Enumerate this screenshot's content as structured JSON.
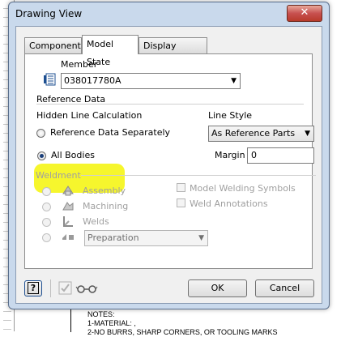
{
  "window": {
    "title": "Drawing View",
    "close_label": "✕"
  },
  "tabs": [
    {
      "label": "Component"
    },
    {
      "label": "Model State"
    },
    {
      "label": "Display Options"
    }
  ],
  "member": {
    "label": "Member",
    "value": "038017780A"
  },
  "reference_data": {
    "group_label": "Reference Data",
    "hidden_line_label": "Hidden Line Calculation",
    "option_separately": "Reference Data Separately",
    "option_all_bodies": "All Bodies",
    "selected": "All Bodies",
    "line_style_label": "Line Style",
    "line_style_value": "As Reference Parts",
    "margin_label": "Margin",
    "margin_value": "0"
  },
  "weldment": {
    "group_label": "Weldment",
    "items": [
      "Assembly",
      "Machining",
      "Welds"
    ],
    "preparation_value": "Preparation",
    "model_welding_symbols": "Model Welding Symbols",
    "weld_annotations": "Weld Annotations"
  },
  "footer": {
    "ok_label": "OK",
    "cancel_label": "Cancel",
    "help_label": "?"
  },
  "background": {
    "notes": [
      "NOTES:",
      "1-MATERIAL: ,",
      "2-NO BURRS, SHARP CORNERS, OR TOOLING MARKS"
    ]
  },
  "colors": {
    "highlight": "#f5f522",
    "window_frame": "#c9d9ec",
    "close_button": "#c75050"
  }
}
